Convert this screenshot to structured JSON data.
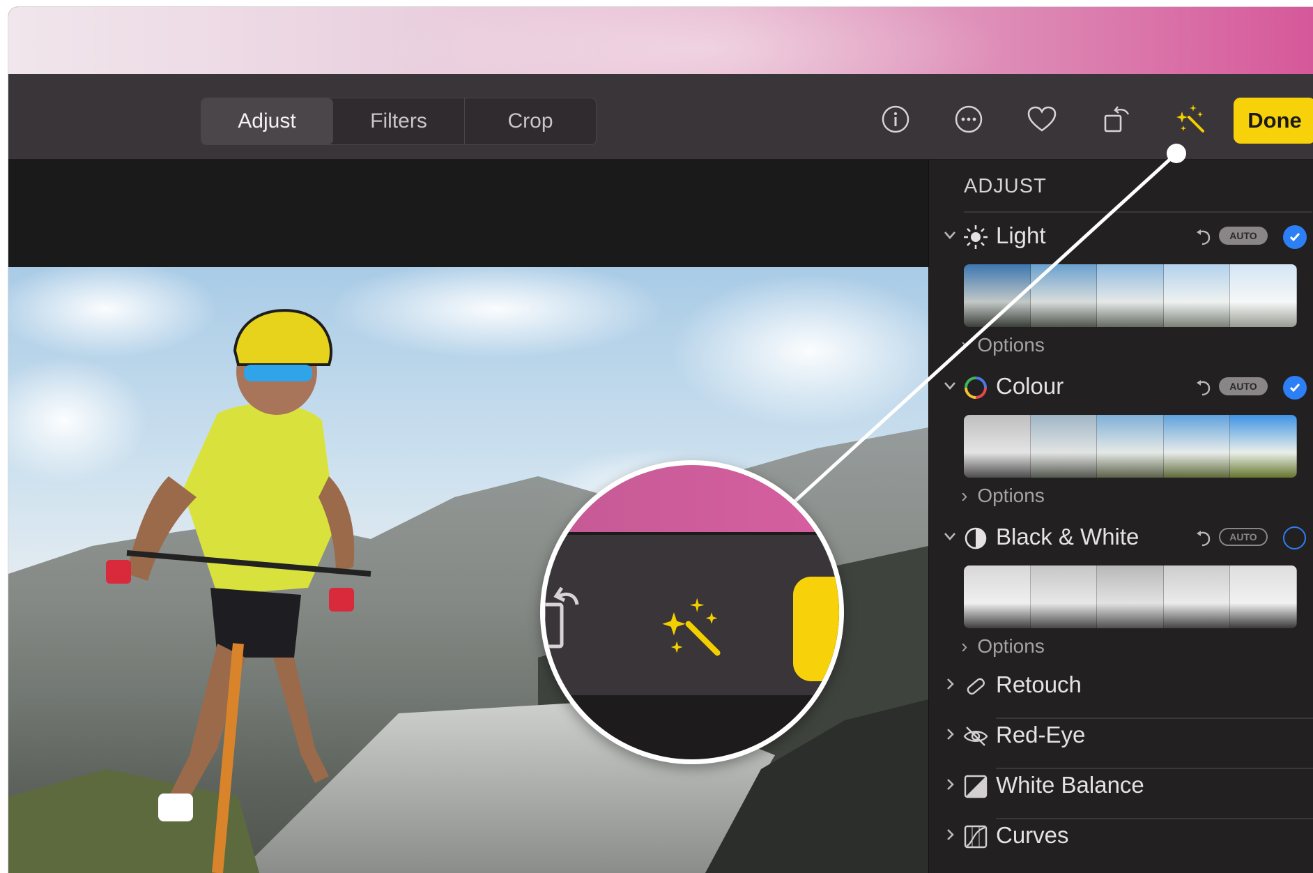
{
  "toolbar": {
    "tabs": [
      {
        "label": "Adjust",
        "active": true
      },
      {
        "label": "Filters",
        "active": false
      },
      {
        "label": "Crop",
        "active": false
      }
    ],
    "icons": [
      "info-icon",
      "more-icon",
      "heart-icon",
      "rotate-icon",
      "magic-wand-icon"
    ],
    "done_label": "Done"
  },
  "sidebar": {
    "title": "ADJUST",
    "sections": [
      {
        "label": "Light",
        "icon": "sun-icon",
        "auto_label": "AUTO",
        "checked": true,
        "options_label": "Options"
      },
      {
        "label": "Colour",
        "icon": "color-wheel-icon",
        "auto_label": "AUTO",
        "checked": true,
        "options_label": "Options"
      },
      {
        "label": "Black & White",
        "icon": "half-circle-icon",
        "auto_label": "AUTO",
        "checked": false,
        "options_label": "Options"
      }
    ],
    "collapsed": [
      {
        "label": "Retouch",
        "icon": "bandage-icon"
      },
      {
        "label": "Red-Eye",
        "icon": "eye-icon"
      },
      {
        "label": "White Balance",
        "icon": "white-balance-icon"
      },
      {
        "label": "Curves",
        "icon": "curves-icon"
      }
    ]
  },
  "colors": {
    "accent_blue": "#2d7ff5",
    "done_yellow": "#f7d20a",
    "wand_yellow": "#f2d000"
  }
}
